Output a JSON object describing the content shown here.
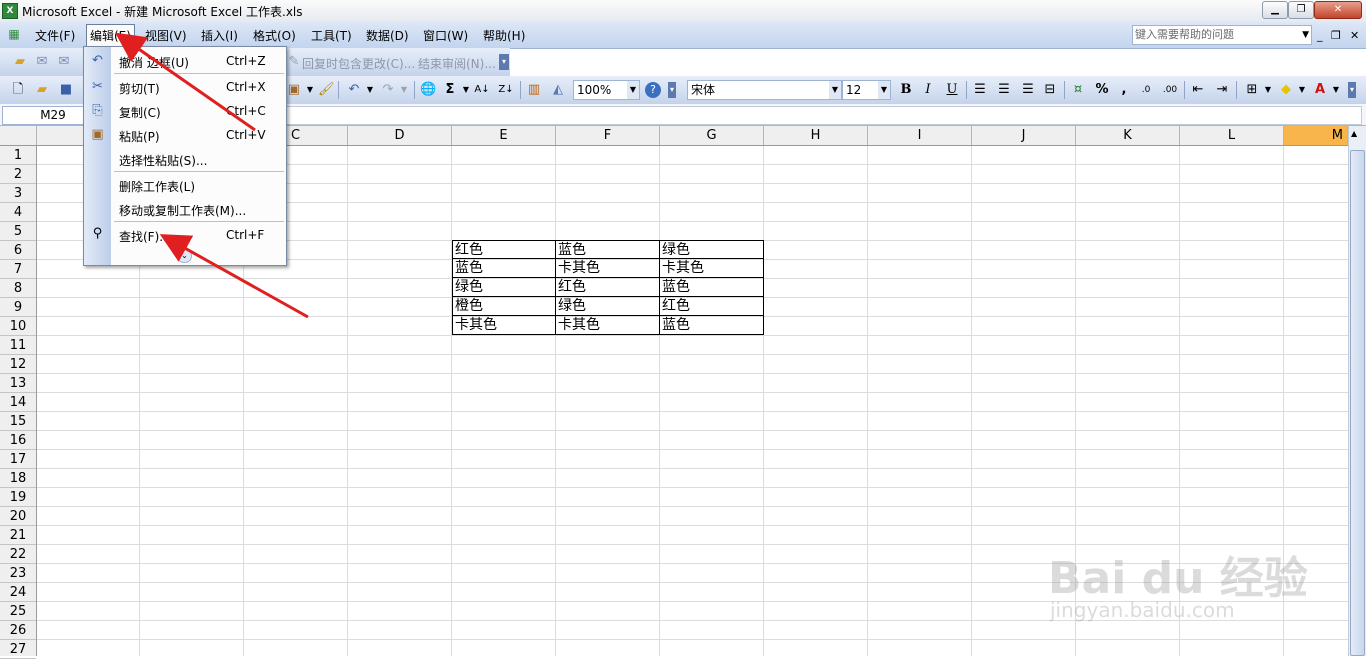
{
  "window": {
    "title": "Microsoft Excel - 新建 Microsoft Excel 工作表.xls"
  },
  "menubar": {
    "items": [
      "文件(F)",
      "编辑(E)",
      "视图(V)",
      "插入(I)",
      "格式(O)",
      "工具(T)",
      "数据(D)",
      "窗口(W)",
      "帮助(H)"
    ],
    "help_placeholder": "键入需要帮助的问题"
  },
  "toolbar1": {
    "reply_changes": "回复时包含更改(C)...",
    "end_review": "结束审阅(N)..."
  },
  "toolbar2": {
    "zoom": "100%",
    "font_name": "宋体",
    "font_size": "12",
    "bold": "B",
    "italic": "I",
    "underline": "U"
  },
  "formulabar": {
    "namebox": "M29"
  },
  "grid": {
    "columns": [
      "C",
      "D",
      "E",
      "F",
      "G",
      "H",
      "I",
      "J",
      "K",
      "L",
      "M"
    ],
    "rows": [
      "1",
      "2",
      "3",
      "4",
      "5",
      "6",
      "7",
      "8",
      "9",
      "10",
      "11",
      "12",
      "13",
      "14",
      "15",
      "16",
      "17",
      "18",
      "19",
      "20",
      "21",
      "22",
      "23",
      "24",
      "25",
      "26",
      "27"
    ],
    "table": [
      [
        "红色",
        "蓝色",
        "绿色"
      ],
      [
        "蓝色",
        "卡其色",
        "卡其色"
      ],
      [
        "绿色",
        "红色",
        "蓝色"
      ],
      [
        "橙色",
        "绿色",
        "红色"
      ],
      [
        "卡其色",
        "卡其色",
        "蓝色"
      ]
    ]
  },
  "edit_menu": {
    "items": [
      {
        "label": "撤消 边框(U)",
        "shortcut": "Ctrl+Z"
      },
      {
        "label": "剪切(T)",
        "shortcut": "Ctrl+X"
      },
      {
        "label": "复制(C)",
        "shortcut": "Ctrl+C"
      },
      {
        "label": "粘贴(P)",
        "shortcut": "Ctrl+V"
      },
      {
        "label": "选择性粘贴(S)...",
        "shortcut": ""
      },
      {
        "label": "删除工作表(L)",
        "shortcut": ""
      },
      {
        "label": "移动或复制工作表(M)...",
        "shortcut": ""
      },
      {
        "label": "查找(F)...",
        "shortcut": "Ctrl+F"
      }
    ]
  },
  "watermark": {
    "brand": "Bai du 经验",
    "url": "jingyan.baidu.com"
  },
  "colors": {
    "arrow": "#e02020",
    "selected_column": "#f7b54b"
  }
}
